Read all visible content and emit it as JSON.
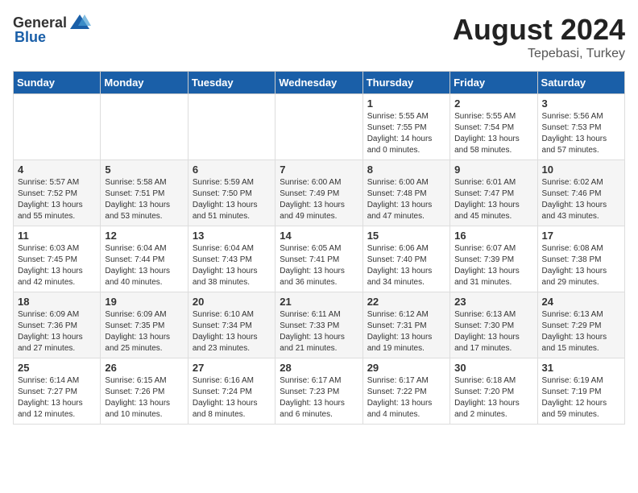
{
  "header": {
    "logo_general": "General",
    "logo_blue": "Blue",
    "month_year": "August 2024",
    "location": "Tepebasi, Turkey"
  },
  "weekdays": [
    "Sunday",
    "Monday",
    "Tuesday",
    "Wednesday",
    "Thursday",
    "Friday",
    "Saturday"
  ],
  "weeks": [
    [
      {
        "day": "",
        "sunrise": "",
        "sunset": "",
        "daylight": ""
      },
      {
        "day": "",
        "sunrise": "",
        "sunset": "",
        "daylight": ""
      },
      {
        "day": "",
        "sunrise": "",
        "sunset": "",
        "daylight": ""
      },
      {
        "day": "",
        "sunrise": "",
        "sunset": "",
        "daylight": ""
      },
      {
        "day": "1",
        "sunrise": "Sunrise: 5:55 AM",
        "sunset": "Sunset: 7:55 PM",
        "daylight": "Daylight: 14 hours and 0 minutes."
      },
      {
        "day": "2",
        "sunrise": "Sunrise: 5:55 AM",
        "sunset": "Sunset: 7:54 PM",
        "daylight": "Daylight: 13 hours and 58 minutes."
      },
      {
        "day": "3",
        "sunrise": "Sunrise: 5:56 AM",
        "sunset": "Sunset: 7:53 PM",
        "daylight": "Daylight: 13 hours and 57 minutes."
      }
    ],
    [
      {
        "day": "4",
        "sunrise": "Sunrise: 5:57 AM",
        "sunset": "Sunset: 7:52 PM",
        "daylight": "Daylight: 13 hours and 55 minutes."
      },
      {
        "day": "5",
        "sunrise": "Sunrise: 5:58 AM",
        "sunset": "Sunset: 7:51 PM",
        "daylight": "Daylight: 13 hours and 53 minutes."
      },
      {
        "day": "6",
        "sunrise": "Sunrise: 5:59 AM",
        "sunset": "Sunset: 7:50 PM",
        "daylight": "Daylight: 13 hours and 51 minutes."
      },
      {
        "day": "7",
        "sunrise": "Sunrise: 6:00 AM",
        "sunset": "Sunset: 7:49 PM",
        "daylight": "Daylight: 13 hours and 49 minutes."
      },
      {
        "day": "8",
        "sunrise": "Sunrise: 6:00 AM",
        "sunset": "Sunset: 7:48 PM",
        "daylight": "Daylight: 13 hours and 47 minutes."
      },
      {
        "day": "9",
        "sunrise": "Sunrise: 6:01 AM",
        "sunset": "Sunset: 7:47 PM",
        "daylight": "Daylight: 13 hours and 45 minutes."
      },
      {
        "day": "10",
        "sunrise": "Sunrise: 6:02 AM",
        "sunset": "Sunset: 7:46 PM",
        "daylight": "Daylight: 13 hours and 43 minutes."
      }
    ],
    [
      {
        "day": "11",
        "sunrise": "Sunrise: 6:03 AM",
        "sunset": "Sunset: 7:45 PM",
        "daylight": "Daylight: 13 hours and 42 minutes."
      },
      {
        "day": "12",
        "sunrise": "Sunrise: 6:04 AM",
        "sunset": "Sunset: 7:44 PM",
        "daylight": "Daylight: 13 hours and 40 minutes."
      },
      {
        "day": "13",
        "sunrise": "Sunrise: 6:04 AM",
        "sunset": "Sunset: 7:43 PM",
        "daylight": "Daylight: 13 hours and 38 minutes."
      },
      {
        "day": "14",
        "sunrise": "Sunrise: 6:05 AM",
        "sunset": "Sunset: 7:41 PM",
        "daylight": "Daylight: 13 hours and 36 minutes."
      },
      {
        "day": "15",
        "sunrise": "Sunrise: 6:06 AM",
        "sunset": "Sunset: 7:40 PM",
        "daylight": "Daylight: 13 hours and 34 minutes."
      },
      {
        "day": "16",
        "sunrise": "Sunrise: 6:07 AM",
        "sunset": "Sunset: 7:39 PM",
        "daylight": "Daylight: 13 hours and 31 minutes."
      },
      {
        "day": "17",
        "sunrise": "Sunrise: 6:08 AM",
        "sunset": "Sunset: 7:38 PM",
        "daylight": "Daylight: 13 hours and 29 minutes."
      }
    ],
    [
      {
        "day": "18",
        "sunrise": "Sunrise: 6:09 AM",
        "sunset": "Sunset: 7:36 PM",
        "daylight": "Daylight: 13 hours and 27 minutes."
      },
      {
        "day": "19",
        "sunrise": "Sunrise: 6:09 AM",
        "sunset": "Sunset: 7:35 PM",
        "daylight": "Daylight: 13 hours and 25 minutes."
      },
      {
        "day": "20",
        "sunrise": "Sunrise: 6:10 AM",
        "sunset": "Sunset: 7:34 PM",
        "daylight": "Daylight: 13 hours and 23 minutes."
      },
      {
        "day": "21",
        "sunrise": "Sunrise: 6:11 AM",
        "sunset": "Sunset: 7:33 PM",
        "daylight": "Daylight: 13 hours and 21 minutes."
      },
      {
        "day": "22",
        "sunrise": "Sunrise: 6:12 AM",
        "sunset": "Sunset: 7:31 PM",
        "daylight": "Daylight: 13 hours and 19 minutes."
      },
      {
        "day": "23",
        "sunrise": "Sunrise: 6:13 AM",
        "sunset": "Sunset: 7:30 PM",
        "daylight": "Daylight: 13 hours and 17 minutes."
      },
      {
        "day": "24",
        "sunrise": "Sunrise: 6:13 AM",
        "sunset": "Sunset: 7:29 PM",
        "daylight": "Daylight: 13 hours and 15 minutes."
      }
    ],
    [
      {
        "day": "25",
        "sunrise": "Sunrise: 6:14 AM",
        "sunset": "Sunset: 7:27 PM",
        "daylight": "Daylight: 13 hours and 12 minutes."
      },
      {
        "day": "26",
        "sunrise": "Sunrise: 6:15 AM",
        "sunset": "Sunset: 7:26 PM",
        "daylight": "Daylight: 13 hours and 10 minutes."
      },
      {
        "day": "27",
        "sunrise": "Sunrise: 6:16 AM",
        "sunset": "Sunset: 7:24 PM",
        "daylight": "Daylight: 13 hours and 8 minutes."
      },
      {
        "day": "28",
        "sunrise": "Sunrise: 6:17 AM",
        "sunset": "Sunset: 7:23 PM",
        "daylight": "Daylight: 13 hours and 6 minutes."
      },
      {
        "day": "29",
        "sunrise": "Sunrise: 6:17 AM",
        "sunset": "Sunset: 7:22 PM",
        "daylight": "Daylight: 13 hours and 4 minutes."
      },
      {
        "day": "30",
        "sunrise": "Sunrise: 6:18 AM",
        "sunset": "Sunset: 7:20 PM",
        "daylight": "Daylight: 13 hours and 2 minutes."
      },
      {
        "day": "31",
        "sunrise": "Sunrise: 6:19 AM",
        "sunset": "Sunset: 7:19 PM",
        "daylight": "Daylight: 12 hours and 59 minutes."
      }
    ]
  ]
}
